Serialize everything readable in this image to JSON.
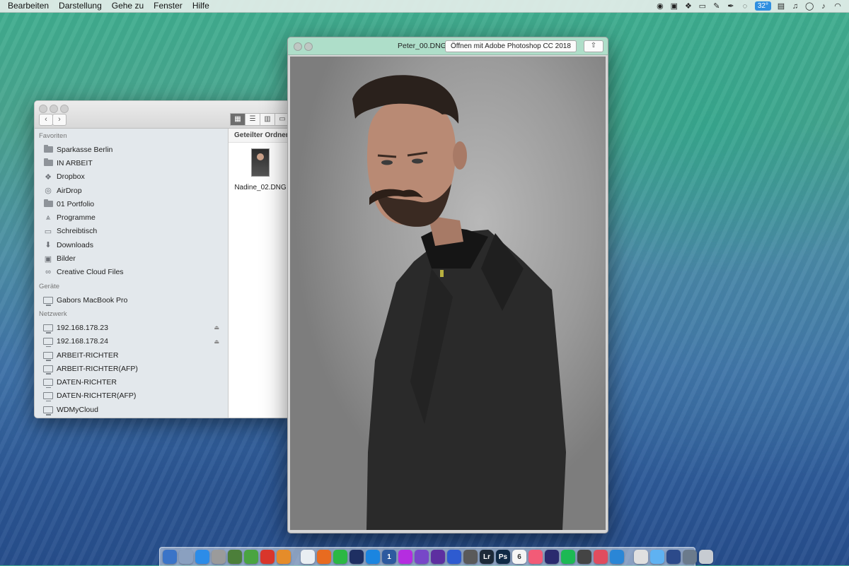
{
  "menubar": {
    "items": [
      "Bearbeiten",
      "Darstellung",
      "Gehe zu",
      "Fenster",
      "Hilfe"
    ],
    "temperature": "32°",
    "status_icons": [
      "record-icon",
      "screen-icon",
      "dropbox-icon",
      "battery-monitor-icon",
      "evernote-icon",
      "pen-icon",
      "cc-icon",
      "temperature-icon",
      "wd-icon",
      "music-icon",
      "sync-icon",
      "volume-icon",
      "wifi-icon"
    ]
  },
  "finder": {
    "favorites_header": "Favoriten",
    "favorites": [
      {
        "label": "Sparkasse Berlin",
        "icon": "folder-icon"
      },
      {
        "label": "IN ARBEIT",
        "icon": "folder-icon"
      },
      {
        "label": "Dropbox",
        "icon": "dropbox-icon"
      },
      {
        "label": "AirDrop",
        "icon": "airdrop-icon"
      },
      {
        "label": "01 Portfolio",
        "icon": "folder-icon"
      },
      {
        "label": "Programme",
        "icon": "applications-icon"
      },
      {
        "label": "Schreibtisch",
        "icon": "desktop-icon"
      },
      {
        "label": "Downloads",
        "icon": "downloads-icon"
      },
      {
        "label": "Bilder",
        "icon": "camera-icon"
      },
      {
        "label": "Creative Cloud Files",
        "icon": "creative-cloud-icon"
      }
    ],
    "devices_header": "Geräte",
    "devices": [
      {
        "label": "Gabors MacBook Pro",
        "icon": "laptop-icon"
      }
    ],
    "network_header": "Netzwerk",
    "network": [
      {
        "label": "192.168.178.23",
        "eject": true
      },
      {
        "label": "192.168.178.24",
        "eject": true
      },
      {
        "label": "ARBEIT-RICHTER",
        "eject": false
      },
      {
        "label": "ARBEIT-RICHTER(AFP)",
        "eject": false
      },
      {
        "label": "DATEN-RICHTER",
        "eject": false
      },
      {
        "label": "DATEN-RICHTER(AFP)",
        "eject": false
      },
      {
        "label": "WDMyCloud",
        "eject": false
      }
    ],
    "column_header": "Geteilter Ordner",
    "file_name": "Nadine_02.DNG"
  },
  "preview": {
    "file_name": "Peter_00.DNG",
    "open_button": "Öffnen mit Adobe Photoshop CC 2018"
  },
  "dock": {
    "apps": [
      {
        "label": "",
        "color": "#3a74c8",
        "icon": "finder-icon"
      },
      {
        "label": "",
        "color": "#8aa0c0",
        "icon": "system-prefs-icon"
      },
      {
        "label": "",
        "color": "#2c8ce8",
        "icon": "safari-icon"
      },
      {
        "label": "",
        "color": "#9b9b9b",
        "icon": "rocket-icon"
      },
      {
        "label": "",
        "color": "#4c7f3a",
        "icon": "notes-icon"
      },
      {
        "label": "",
        "color": "#4aa441",
        "icon": "evernote-icon"
      },
      {
        "label": "",
        "color": "#d9362b",
        "icon": "star-icon"
      },
      {
        "label": "",
        "color": "#e58c2a",
        "icon": "sketch-icon"
      },
      {
        "sep": true
      },
      {
        "label": "",
        "color": "#e9eef2",
        "icon": "mail-icon"
      },
      {
        "label": "",
        "color": "#e86b20",
        "icon": "firefox-icon"
      },
      {
        "label": "",
        "color": "#2bb844",
        "icon": "whatsapp-icon"
      },
      {
        "label": "",
        "color": "#1e2f62",
        "icon": "affinity-icon"
      },
      {
        "label": "",
        "color": "#1b85e0",
        "icon": "vpn-icon"
      },
      {
        "label": "1",
        "color": "#2d5a9f",
        "icon": "onepassword-icon"
      },
      {
        "label": "",
        "color": "#b52de0",
        "icon": "brush-icon"
      },
      {
        "label": "",
        "color": "#7747c8",
        "icon": "affinity-photo-icon"
      },
      {
        "label": "",
        "color": "#5d2fa0",
        "icon": "affinity-designer-icon"
      },
      {
        "label": "",
        "color": "#2e5bd0",
        "icon": "keynote-icon"
      },
      {
        "label": "",
        "color": "#5a5a5a",
        "icon": "grid-icon"
      },
      {
        "label": "Lr",
        "color": "#1d2a38",
        "icon": "lightroom-icon"
      },
      {
        "label": "Ps",
        "color": "#0f2a45",
        "icon": "photoshop-icon"
      },
      {
        "label": "6",
        "color": "#f5f5f5",
        "icon": "calendar-icon"
      },
      {
        "label": "",
        "color": "#f25b77",
        "icon": "itunes-icon"
      },
      {
        "label": "",
        "color": "#2a2a6e",
        "icon": "music-icon"
      },
      {
        "label": "",
        "color": "#1db954",
        "icon": "spotify-icon"
      },
      {
        "label": "",
        "color": "#444",
        "icon": "steam-icon"
      },
      {
        "label": "",
        "color": "#e04c5e",
        "icon": "cleaner-icon"
      },
      {
        "label": "",
        "color": "#2a86d6",
        "icon": "camtasia-icon"
      },
      {
        "sep": true
      },
      {
        "label": "",
        "color": "#e0e0e0",
        "icon": "document-icon"
      },
      {
        "label": "",
        "color": "#5fb2f2",
        "icon": "folder-icon"
      },
      {
        "label": "",
        "color": "#2c4a8a",
        "icon": "downloads-stack-icon"
      },
      {
        "label": "",
        "color": "#6b7b8c",
        "icon": "screenshot-icon"
      },
      {
        "label": "",
        "color": "#c7ccd2",
        "icon": "trash-icon"
      }
    ]
  }
}
